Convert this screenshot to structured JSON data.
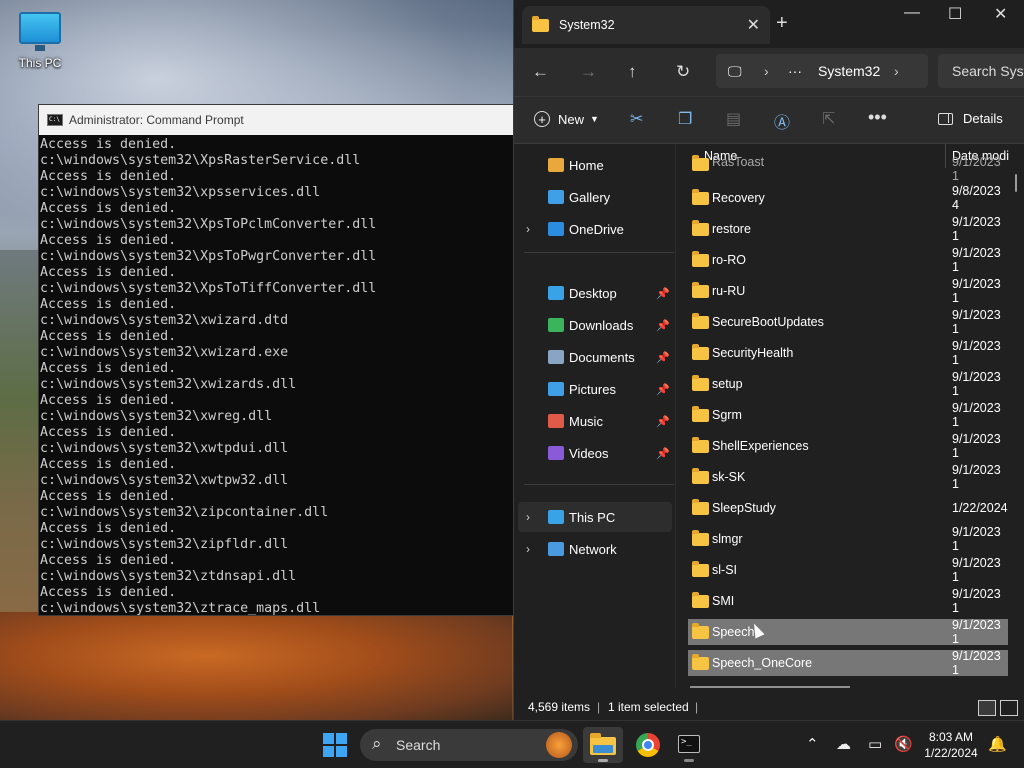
{
  "desktop": {
    "icons": [
      {
        "label": "This PC",
        "icon": "this-pc-icon"
      }
    ]
  },
  "cmd": {
    "title": "Administrator: Command Prompt",
    "lines": [
      "Access is denied.",
      "c:\\windows\\system32\\XpsRasterService.dll",
      "Access is denied.",
      "c:\\windows\\system32\\xpsservices.dll",
      "Access is denied.",
      "c:\\windows\\system32\\XpsToPclmConverter.dll",
      "Access is denied.",
      "c:\\windows\\system32\\XpsToPwgrConverter.dll",
      "Access is denied.",
      "c:\\windows\\system32\\XpsToTiffConverter.dll",
      "Access is denied.",
      "c:\\windows\\system32\\xwizard.dtd",
      "Access is denied.",
      "c:\\windows\\system32\\xwizard.exe",
      "Access is denied.",
      "c:\\windows\\system32\\xwizards.dll",
      "Access is denied.",
      "c:\\windows\\system32\\xwreg.dll",
      "Access is denied.",
      "c:\\windows\\system32\\xwtpdui.dll",
      "Access is denied.",
      "c:\\windows\\system32\\xwtpw32.dll",
      "Access is denied.",
      "c:\\windows\\system32\\zipcontainer.dll",
      "Access is denied.",
      "c:\\windows\\system32\\zipfldr.dll",
      "Access is denied.",
      "c:\\windows\\system32\\ztdnsapi.dll",
      "Access is denied.",
      "c:\\windows\\system32\\ztrace_maps.dll"
    ]
  },
  "explorer": {
    "tab_title": "System32",
    "window_controls": {
      "minimize": "—",
      "maximize": "☐",
      "close": "✕"
    },
    "address": {
      "more": "···",
      "current": "System32"
    },
    "search_placeholder": "Search Syste",
    "toolbar": {
      "new_label": "New",
      "details_label": "Details"
    },
    "nav": [
      {
        "label": "Home",
        "icon": "home-icon",
        "color": "#e8a83b",
        "expandable": false,
        "pinned": false
      },
      {
        "label": "Gallery",
        "icon": "gallery-icon",
        "color": "#3fa0e8",
        "expandable": false,
        "pinned": false
      },
      {
        "label": "OneDrive",
        "icon": "onedrive-icon",
        "color": "#2b8de0",
        "expandable": true,
        "pinned": false
      },
      {
        "label": "Desktop",
        "icon": "desktop-icon",
        "color": "#3aa2e6",
        "expandable": false,
        "pinned": true
      },
      {
        "label": "Downloads",
        "icon": "downloads-icon",
        "color": "#3bb55d",
        "expandable": false,
        "pinned": true
      },
      {
        "label": "Documents",
        "icon": "documents-icon",
        "color": "#8aa4c4",
        "expandable": false,
        "pinned": true
      },
      {
        "label": "Pictures",
        "icon": "pictures-icon",
        "color": "#3fa0e8",
        "expandable": false,
        "pinned": true
      },
      {
        "label": "Music",
        "icon": "music-icon",
        "color": "#e05a4a",
        "expandable": false,
        "pinned": true
      },
      {
        "label": "Videos",
        "icon": "videos-icon",
        "color": "#8a5ad8",
        "expandable": false,
        "pinned": true
      },
      {
        "label": "This PC",
        "icon": "this-pc-icon",
        "color": "#3aa2e6",
        "expandable": true,
        "pinned": false
      },
      {
        "label": "Network",
        "icon": "network-icon",
        "color": "#4a9ae0",
        "expandable": true,
        "pinned": false
      }
    ],
    "columns": {
      "name": "Name",
      "date": "Date modi"
    },
    "files": [
      {
        "name": "RasToast",
        "date": "9/1/2023 1",
        "selected": false
      },
      {
        "name": "Recovery",
        "date": "9/8/2023 4",
        "selected": false
      },
      {
        "name": "restore",
        "date": "9/1/2023 1",
        "selected": false
      },
      {
        "name": "ro-RO",
        "date": "9/1/2023 1",
        "selected": false
      },
      {
        "name": "ru-RU",
        "date": "9/1/2023 1",
        "selected": false
      },
      {
        "name": "SecureBootUpdates",
        "date": "9/1/2023 1",
        "selected": false
      },
      {
        "name": "SecurityHealth",
        "date": "9/1/2023 1",
        "selected": false
      },
      {
        "name": "setup",
        "date": "9/1/2023 1",
        "selected": false
      },
      {
        "name": "Sgrm",
        "date": "9/1/2023 1",
        "selected": false
      },
      {
        "name": "ShellExperiences",
        "date": "9/1/2023 1",
        "selected": false
      },
      {
        "name": "sk-SK",
        "date": "9/1/2023 1",
        "selected": false
      },
      {
        "name": "SleepStudy",
        "date": "1/22/2024",
        "selected": false
      },
      {
        "name": "slmgr",
        "date": "9/1/2023 1",
        "selected": false
      },
      {
        "name": "sl-SI",
        "date": "9/1/2023 1",
        "selected": false
      },
      {
        "name": "SMI",
        "date": "9/1/2023 1",
        "selected": false
      },
      {
        "name": "Speech",
        "date": "9/1/2023 1",
        "selected": true
      },
      {
        "name": "Speech_OneCore",
        "date": "9/1/2023 1",
        "selected": true
      }
    ],
    "status": {
      "items": "4,569 items",
      "selected": "1 item selected"
    }
  },
  "taskbar": {
    "search_label": "Search",
    "time": "8:03 AM",
    "date": "1/22/2024",
    "apps": [
      "file-explorer-icon",
      "chrome-icon",
      "terminal-icon"
    ]
  }
}
